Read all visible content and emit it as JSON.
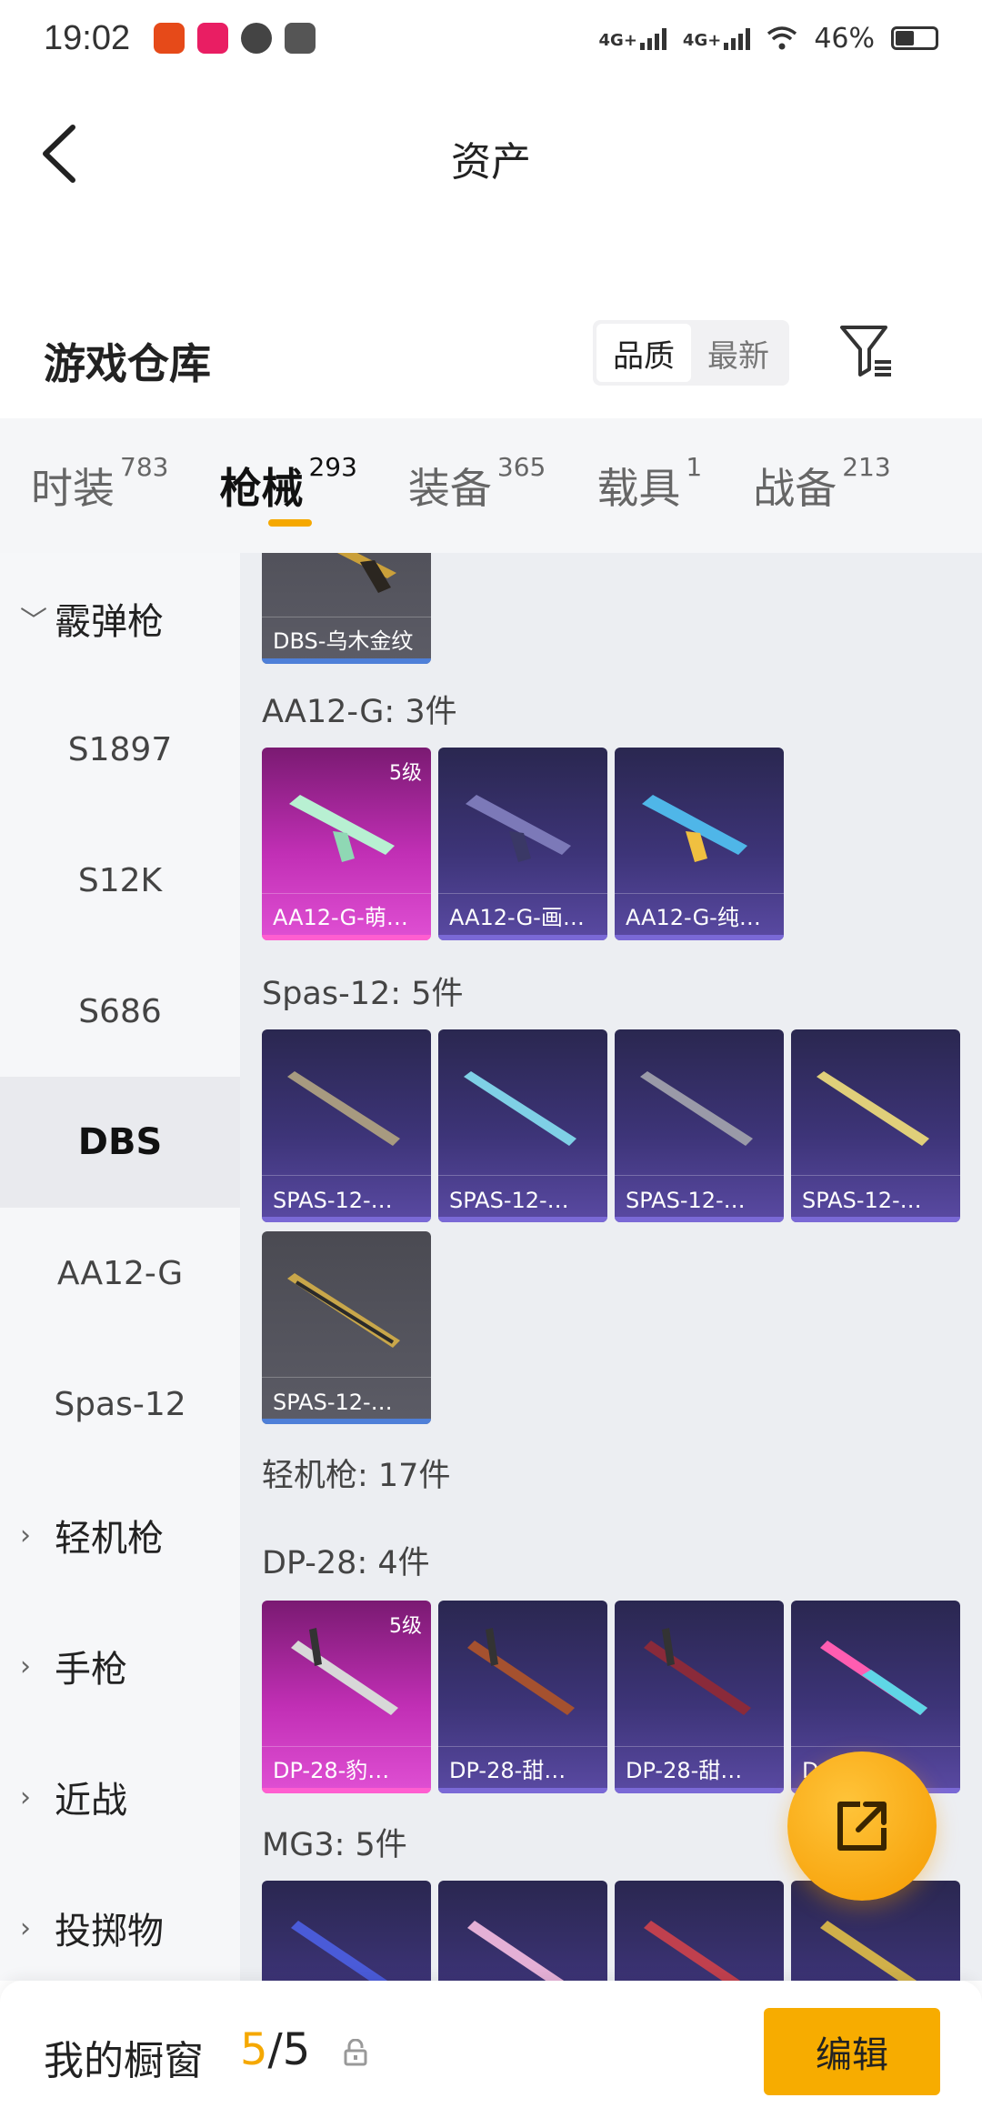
{
  "status_bar": {
    "time": "19:02",
    "signal_1": "4G+",
    "signal_2": "4G+",
    "battery": "46%",
    "battery_level": 0.46
  },
  "header": {
    "title": "资产"
  },
  "warehouse": {
    "title": "游戏仓库",
    "sort_options": [
      "品质",
      "最新"
    ],
    "sort_selected": "品质"
  },
  "tabs": [
    {
      "label": "时装",
      "count": "783"
    },
    {
      "label": "枪械",
      "count": "293",
      "active": true
    },
    {
      "label": "装备",
      "count": "365"
    },
    {
      "label": "载具",
      "count": "1"
    },
    {
      "label": "战备",
      "count": "213"
    }
  ],
  "categories": [
    {
      "label": "霰弹枪",
      "type": "group",
      "expanded": true
    },
    {
      "label": "S1897",
      "type": "sub"
    },
    {
      "label": "S12K",
      "type": "sub"
    },
    {
      "label": "S686",
      "type": "sub"
    },
    {
      "label": "DBS",
      "type": "sub",
      "selected": true
    },
    {
      "label": "AA12-G",
      "type": "sub"
    },
    {
      "label": "Spas-12",
      "type": "sub"
    },
    {
      "label": "轻机枪",
      "type": "group"
    },
    {
      "label": "手枪",
      "type": "group"
    },
    {
      "label": "近战",
      "type": "group"
    },
    {
      "label": "投掷物",
      "type": "group"
    }
  ],
  "groups": {
    "aa12": "AA12-G: 3件",
    "spas": "Spas-12: 5件",
    "lmg": "轻机枪: 17件",
    "dp28": "DP-28: 4件",
    "mg3": "MG3: 5件"
  },
  "cards": {
    "dbs_1": {
      "name": "DBS-乌木金纹"
    },
    "aa12_1": {
      "name": "AA12-G-萌…",
      "level": "5级"
    },
    "aa12_2": {
      "name": "AA12-G-画…"
    },
    "aa12_3": {
      "name": "AA12-G-纯…"
    },
    "spas_1": {
      "name": "SPAS-12-…"
    },
    "spas_2": {
      "name": "SPAS-12-…"
    },
    "spas_3": {
      "name": "SPAS-12-…"
    },
    "spas_4": {
      "name": "SPAS-12-…"
    },
    "spas_5": {
      "name": "SPAS-12-…"
    },
    "dp28_1": {
      "name": "DP-28-豹…",
      "level": "5级"
    },
    "dp28_2": {
      "name": "DP-28-甜…"
    },
    "dp28_3": {
      "name": "DP-28-甜…"
    },
    "dp28_4": {
      "name": "D…彩…"
    }
  },
  "bottom_bar": {
    "label": "我的橱窗",
    "current": "5",
    "separator": "/",
    "total": "5",
    "edit_label": "编辑"
  },
  "colors": {
    "accent": "#f5a800",
    "rarity_purple": "#5a4aa3",
    "rarity_pink": "#c12fb5",
    "rarity_grey": "#5c5c66"
  }
}
